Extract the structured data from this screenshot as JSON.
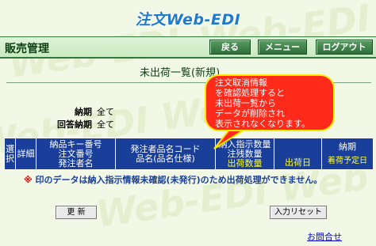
{
  "app": {
    "logo": "注文Web-EDI"
  },
  "header": {
    "page_title": "販売管理",
    "back_label": "戻る",
    "menu_label": "メニュー",
    "logout_label": "ログアウト"
  },
  "main": {
    "subtitle": "未出荷一覧(新規)",
    "filters": [
      {
        "label": "納期",
        "value": "全て"
      },
      {
        "label": "回答納期",
        "value": "全て"
      }
    ]
  },
  "table": {
    "headers": {
      "select": "選択",
      "detail": "詳細",
      "key": [
        "納品キー番号",
        "注文番号",
        "発注者名"
      ],
      "item": [
        "発注者品名コード",
        "品名(品名仕様)"
      ],
      "qty": [
        "納入指示数量",
        "注残数量",
        "出荷数量"
      ],
      "ship_date": "出荷日",
      "due": [
        "納期",
        "着荷予定日"
      ]
    }
  },
  "notice": {
    "mark": "※",
    "text": "印のデータは納入指示情報未確認(未発行)のため出荷処理ができません。"
  },
  "buttons": {
    "update": "更 新",
    "reset": "入力リセット"
  },
  "footer": {
    "contact": "お問合せ"
  },
  "callout": {
    "lines": [
      "注文取消情報",
      "を確認処理すると",
      "未出荷一覧から",
      "データが削除され",
      "表示されなくなります。"
    ]
  },
  "colors": {
    "header_blue": "#1a3f9a",
    "highlight_yellow": "#ffff33",
    "callout_red": "#ff2a1a",
    "brand_green": "#2f6e39"
  }
}
